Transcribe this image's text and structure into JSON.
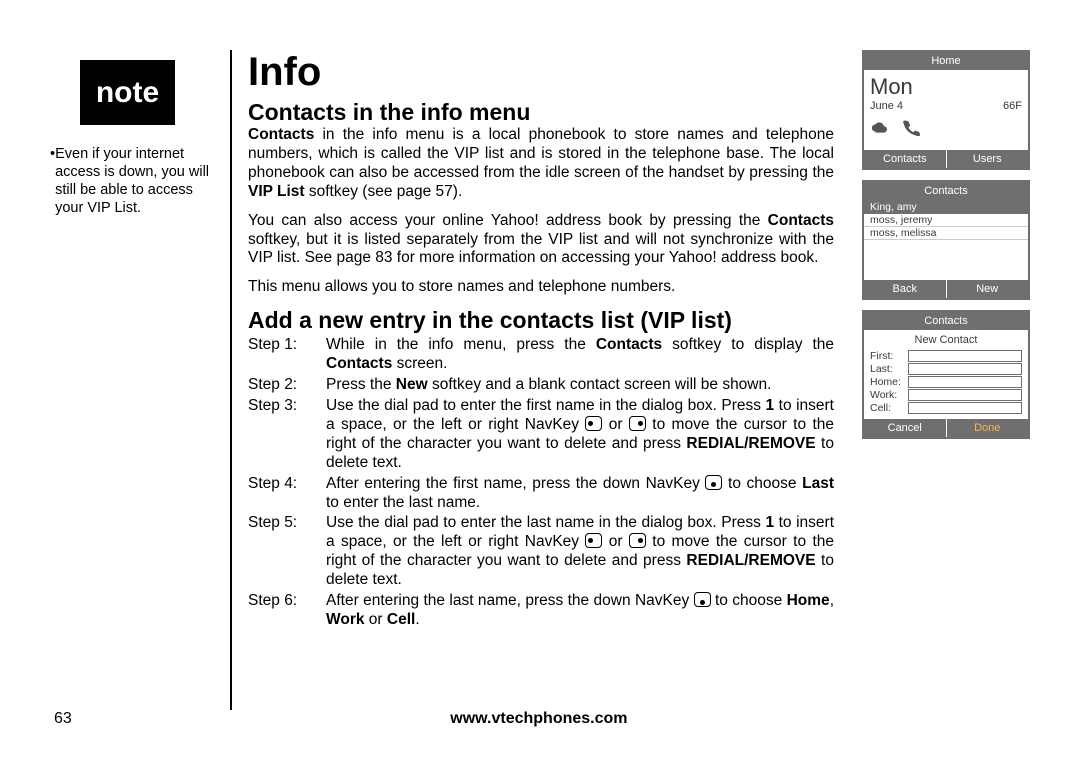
{
  "sidebar": {
    "note_label": "note",
    "bullet": "Even if your internet access is down, you will still be able to access your VIP List."
  },
  "main": {
    "h1": "Info",
    "h2a": "Contacts in the info menu",
    "p1a": "Contacts",
    "p1b": " in the info menu is a local phonebook to store names and telephone numbers, which is called the VIP list and is stored in the telephone base. The local phonebook can also be accessed from the idle screen of the handset by pressing the ",
    "p1c": "VIP List",
    "p1d": " softkey (see page 57).",
    "p2a": "You can also access your online Yahoo! address book by pressing the ",
    "p2b": "Contacts",
    "p2c": " softkey, but it is listed separately from the VIP list and will not synchronize with the VIP list. See page 83 for more information on accessing your Yahoo! address book.",
    "p3": "This menu allows you to store names and telephone numbers.",
    "h2b": "Add a new entry in the contacts list (VIP list)",
    "steps": [
      {
        "label": "Step 1:",
        "b1": "Contacts",
        "t1": "While in the info menu, press the ",
        "t2": " softkey to display the ",
        "b2": "Contacts",
        "t3": " screen."
      },
      {
        "label": "Step 2:",
        "t1": "Press the ",
        "b1": "New",
        "t2": " softkey and a blank contact screen will be shown."
      },
      {
        "label": "Step 3:",
        "t1": "Use the dial pad to enter the first name in the dialog box. Press ",
        "b1": "1",
        "t2": " to insert a space, or the left or right NavKey ",
        "t3": " or ",
        "t4": " to move the cursor to the right of the character you want to delete and press ",
        "b2": "REDIAL/REMOVE",
        "t5": " to delete text."
      },
      {
        "label": "Step 4:",
        "t1": "After entering the first name, press the down NavKey ",
        "t2": " to choose ",
        "b1": "Last",
        "t3": " to enter the last name."
      },
      {
        "label": "Step 5:",
        "t1": "Use the dial pad to enter the last name in the dialog box. Press ",
        "b1": "1",
        "t2": " to insert a space, or the left or right NavKey ",
        "t3": " or ",
        "t4": " to move the cursor to the right of the character you want to delete and press ",
        "b2": "REDIAL/REMOVE",
        "t5": " to delete text."
      },
      {
        "label": "Step 6:",
        "t1": "After entering the last name, press the down NavKey ",
        "t2": " to choose ",
        "b1": "Home",
        "t3": ", ",
        "b2": "Work",
        "t4": " or ",
        "b3": "Cell",
        "t5": "."
      }
    ]
  },
  "phones": {
    "p1": {
      "hdr": "Home",
      "day": "Mon",
      "date": "June 4",
      "temp": "66F",
      "sk1": "Contacts",
      "sk2": "Users"
    },
    "p2": {
      "hdr": "Contacts",
      "sel": "King, amy",
      "i1": "moss, jeremy",
      "i2": "moss, melissa",
      "sk1": "Back",
      "sk2": "New"
    },
    "p3": {
      "hdr": "Contacts",
      "title": "New Contact",
      "f1": "First:",
      "f2": "Last:",
      "f3": "Home:",
      "f4": "Work:",
      "f5": "Cell:",
      "sk1": "Cancel",
      "sk2": "Done"
    }
  },
  "footer": {
    "page": "63",
    "url": "www.vtechphones.com"
  }
}
